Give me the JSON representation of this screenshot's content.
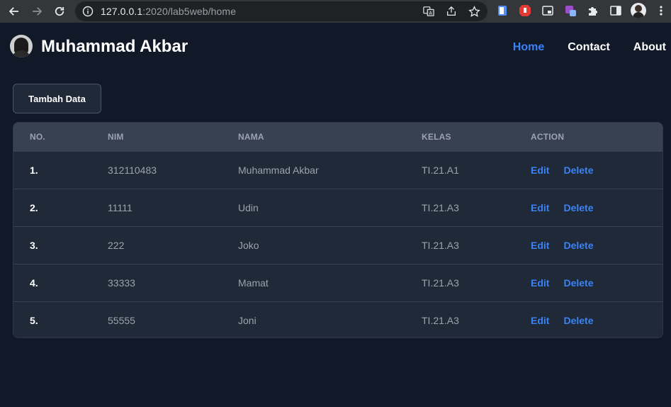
{
  "browser": {
    "url_host": "127.0.0.1",
    "url_rest": ":2020/lab5web/home",
    "icons": [
      "back-icon",
      "forward-icon",
      "reload-icon",
      "info-icon",
      "translate-icon",
      "share-icon",
      "star-icon",
      "extension-icons",
      "puzzle-icon",
      "sidebar-icon",
      "profile-avatar",
      "more-icon"
    ]
  },
  "nav": {
    "brand": "Muhammad Akbar",
    "links": [
      {
        "label": "Home",
        "active": true
      },
      {
        "label": "Contact",
        "active": false
      },
      {
        "label": "About",
        "active": false
      }
    ]
  },
  "actions": {
    "add_label": "Tambah Data"
  },
  "table": {
    "headers": [
      "NO.",
      "NIM",
      "NAMA",
      "KELAS",
      "ACTION"
    ],
    "rows": [
      {
        "no": "1.",
        "nim": "312110483",
        "nama": "Muhammad Akbar",
        "kelas": "TI.21.A1",
        "edit": "Edit",
        "delete": "Delete"
      },
      {
        "no": "2.",
        "nim": "11111",
        "nama": "Udin",
        "kelas": "TI.21.A3",
        "edit": "Edit",
        "delete": "Delete"
      },
      {
        "no": "3.",
        "nim": "222",
        "nama": "Joko",
        "kelas": "TI.21.A3",
        "edit": "Edit",
        "delete": "Delete"
      },
      {
        "no": "4.",
        "nim": "33333",
        "nama": "Mamat",
        "kelas": "TI.21.A3",
        "edit": "Edit",
        "delete": "Delete"
      },
      {
        "no": "5.",
        "nim": "55555",
        "nama": "Joni",
        "kelas": "TI.21.A3",
        "edit": "Edit",
        "delete": "Delete"
      }
    ]
  },
  "colors": {
    "background": "#111827",
    "surface": "#1f2937",
    "header_row": "#374151",
    "accent": "#3b82f6"
  }
}
